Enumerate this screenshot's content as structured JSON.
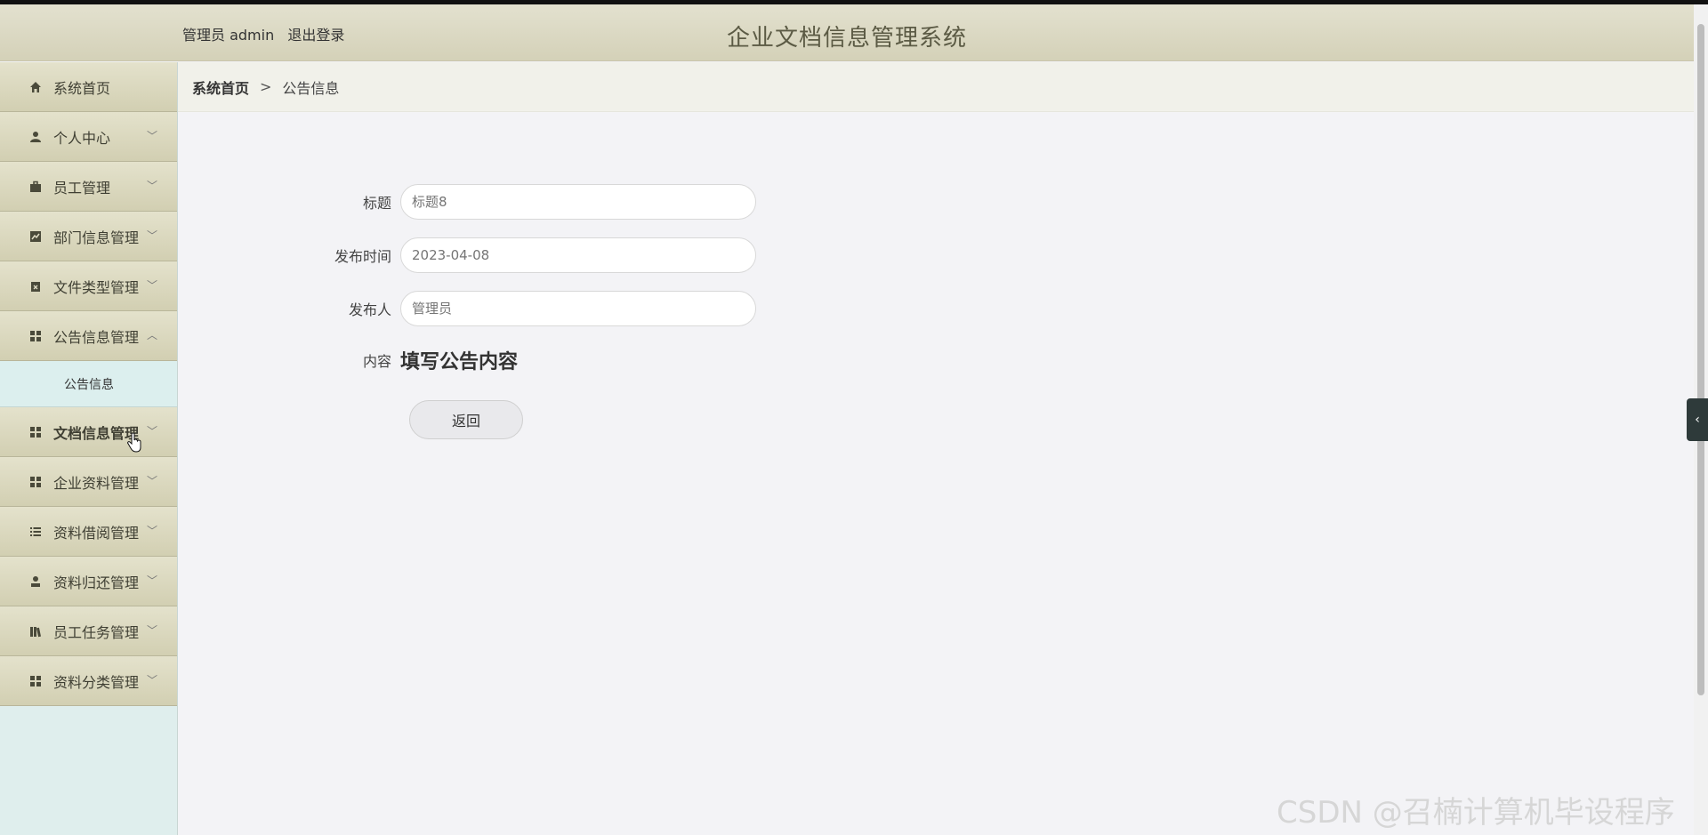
{
  "header": {
    "user_label": "管理员 admin",
    "logout_label": "退出登录",
    "app_title": "企业文档信息管理系统"
  },
  "sidebar": {
    "items": [
      {
        "label": "系统首页",
        "icon": "home-icon",
        "chevron": ""
      },
      {
        "label": "个人中心",
        "icon": "person-icon",
        "chevron": "﹀"
      },
      {
        "label": "员工管理",
        "icon": "briefcase-icon",
        "chevron": "﹀"
      },
      {
        "label": "部门信息管理",
        "icon": "chart-icon",
        "chevron": "﹀"
      },
      {
        "label": "文件类型管理",
        "icon": "clipboard-icon",
        "chevron": "﹀"
      },
      {
        "label": "公告信息管理",
        "icon": "grid-icon",
        "chevron": "︿"
      },
      {
        "label": "文档信息管理",
        "icon": "grid-icon",
        "chevron": "﹀"
      },
      {
        "label": "企业资料管理",
        "icon": "grid-icon",
        "chevron": "﹀"
      },
      {
        "label": "资料借阅管理",
        "icon": "list-icon",
        "chevron": "﹀"
      },
      {
        "label": "资料归还管理",
        "icon": "user-stand-icon",
        "chevron": "﹀"
      },
      {
        "label": "员工任务管理",
        "icon": "books-icon",
        "chevron": "﹀"
      },
      {
        "label": "资料分类管理",
        "icon": "grid-icon",
        "chevron": "﹀"
      }
    ],
    "submenu_label": "公告信息"
  },
  "breadcrumb": {
    "home": "系统首页",
    "separator": ">",
    "current": "公告信息"
  },
  "form": {
    "title_label": "标题",
    "title_placeholder": "标题8",
    "time_label": "发布时间",
    "time_placeholder": "2023-04-08",
    "publisher_label": "发布人",
    "publisher_placeholder": "管理员",
    "content_label": "内容",
    "content_value": "填写公告内容",
    "back_label": "返回"
  },
  "side_toggle": "‹",
  "watermark": "CSDN @召楠计算机毕设程序"
}
